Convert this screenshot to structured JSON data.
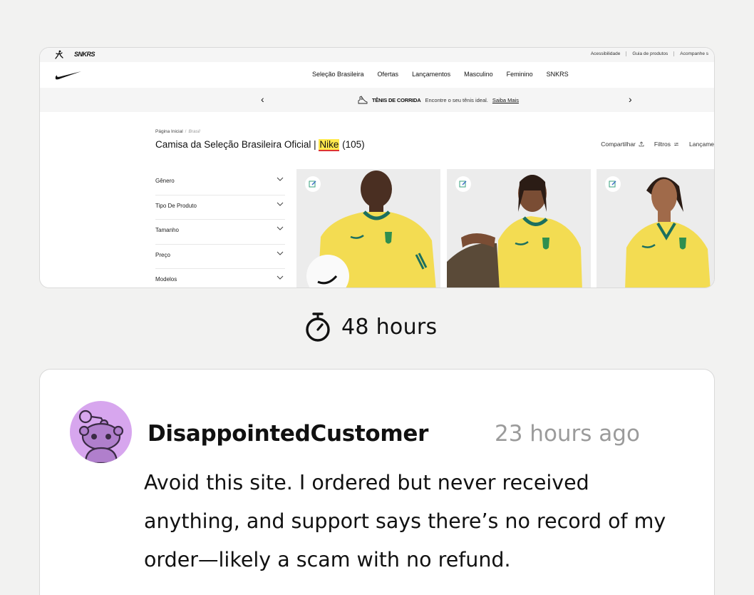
{
  "site": {
    "brand_sub": "SNKRS",
    "utility_links": [
      "Acessibilidade",
      "Guia de produtos",
      "Acompanhe s"
    ],
    "nav_links": [
      "Seleção Brasileira",
      "Ofertas",
      "Lançamentos",
      "Masculino",
      "Feminino",
      "SNKRS"
    ],
    "promo": {
      "prev": "‹",
      "next": "›",
      "title": "TÊNIS DE CORRIDA",
      "text": "Encontre o seu tênis ideal.",
      "link": "Saiba Mais"
    },
    "breadcrumb": [
      "Página Inicial",
      "Brasil"
    ],
    "breadcrumb_sep": "/",
    "page_title": {
      "before": "Camisa da Seleção Brasileira Oficial | ",
      "brand": "Nike",
      "after": " (105)"
    },
    "toolbar": {
      "share": "Compartilhar",
      "filters": "Filtros",
      "sort": "Lançame"
    },
    "filters": [
      "Gênero",
      "Tipo De Produto",
      "Tamanho",
      "Preço",
      "Modelos"
    ],
    "colors": {
      "shirt": "#f3dc52",
      "trim": "#1c6f5f",
      "badge": "#2f8f4f",
      "highlight": "#ffe94d"
    }
  },
  "timer": {
    "icon": "stopwatch-icon",
    "text": "48 hours"
  },
  "review": {
    "avatar_icon": "reddit-alien-avatar",
    "username": "DisappointedCustomer",
    "timestamp": "23 hours ago",
    "body": "Avoid this site. I ordered but never received anything, and support says there’s no record of my order—likely a scam with no refund.",
    "avatar_color": "#d7a6ee"
  }
}
